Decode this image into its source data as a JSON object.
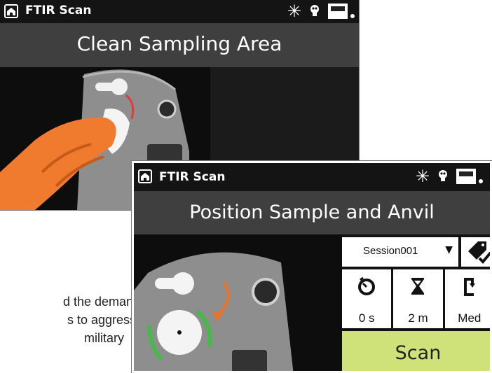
{
  "background_text": {
    "lines": [
      "d the demands",
      "s to aggressive",
      "military"
    ]
  },
  "back_screen": {
    "app_title": "FTIR Scan",
    "instruction": "Clean Sampling Area",
    "icons": [
      "home-icon",
      "laser-icon",
      "bulb-icon",
      "battery-icon"
    ]
  },
  "front_screen": {
    "app_title": "FTIR Scan",
    "instruction": "Position Sample and Anvil",
    "session": {
      "value": "Session001"
    },
    "metrics": [
      {
        "icon": "timer-icon",
        "value": "0 s"
      },
      {
        "icon": "hourglass-icon",
        "value": "2 m"
      },
      {
        "icon": "force-icon",
        "value": "Med"
      }
    ],
    "scan_label": "Scan",
    "colors": {
      "scan_button": "#cfe27a",
      "guide_arc": "#46b94a",
      "hand": "#f07a2e",
      "arrow": "#e8732a"
    }
  }
}
